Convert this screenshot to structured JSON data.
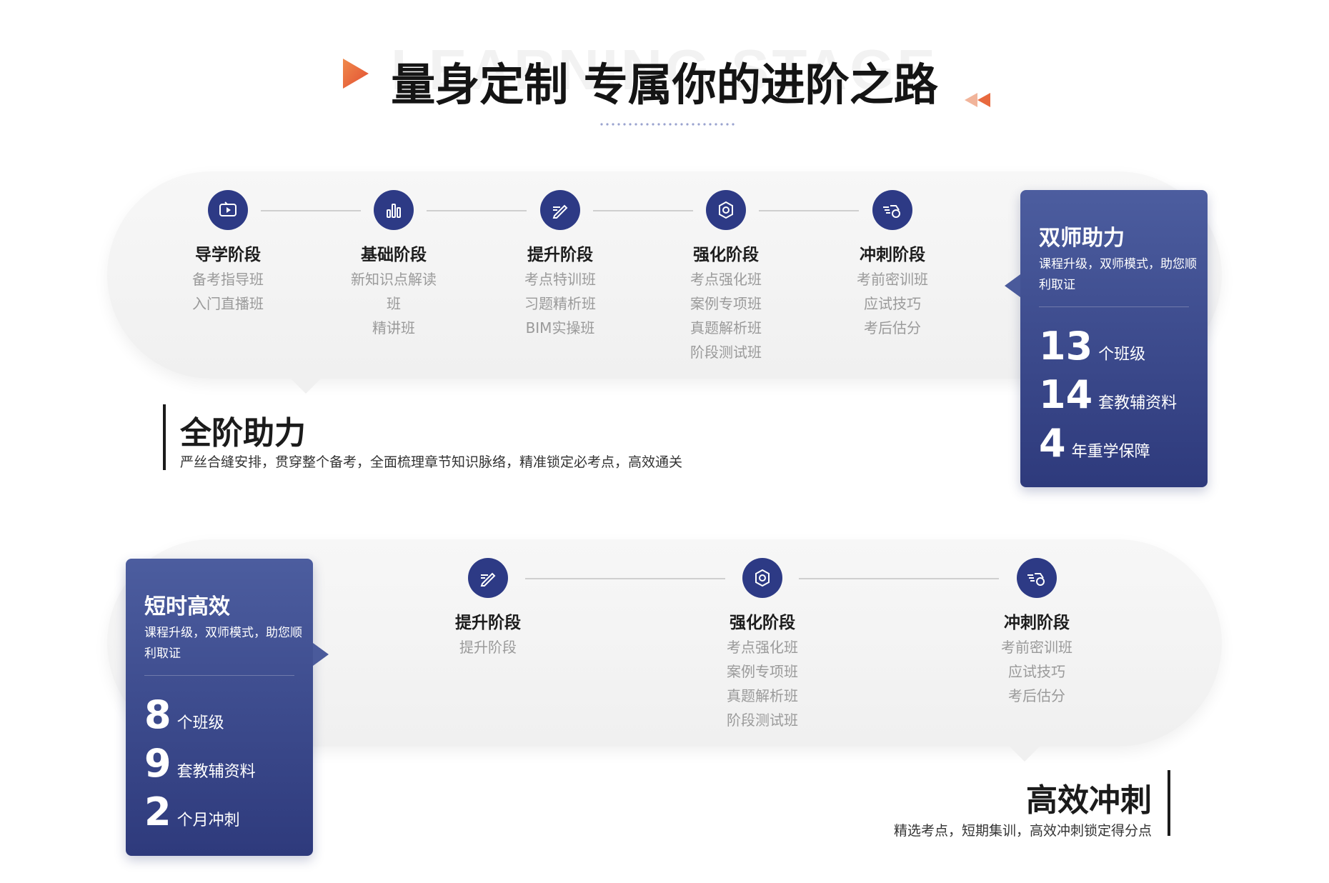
{
  "header": {
    "watermark": "LEARNING STAGE",
    "title": "量身定制 专属你的进阶之路"
  },
  "colors": {
    "accent": "#e8693e",
    "card": "#3a4788",
    "icon": "#2d3a85"
  },
  "section1": {
    "stages": [
      {
        "icon": "video-icon",
        "title": "导学阶段",
        "items": [
          "备考指导班",
          "入门直播班"
        ]
      },
      {
        "icon": "bar-chart-icon",
        "title": "基础阶段",
        "items": [
          "新知识点解读",
          "班",
          "精讲班"
        ]
      },
      {
        "icon": "pen-icon",
        "title": "提升阶段",
        "items": [
          "考点特训班",
          "习题精析班",
          "BIM实操班"
        ]
      },
      {
        "icon": "target-icon",
        "title": "强化阶段",
        "items": [
          "考点强化班",
          "案例专项班",
          "真题解析班",
          "阶段测试班"
        ]
      },
      {
        "icon": "sprint-icon",
        "title": "冲刺阶段",
        "items": [
          "考前密训班",
          "应试技巧",
          "考后估分"
        ]
      }
    ],
    "card": {
      "title": "双师助力",
      "desc": "课程升级，双师模式，助您顺利取证",
      "stats": [
        {
          "num": "13",
          "unit": "个班级"
        },
        {
          "num": "14",
          "unit": "套教辅资料"
        },
        {
          "num": "4",
          "unit": "年重学保障"
        }
      ]
    },
    "label": {
      "title": "全阶助力",
      "desc": "严丝合缝安排，贯穿整个备考，全面梳理章节知识脉络，精准锁定必考点，高效通关"
    }
  },
  "section2": {
    "stages": [
      {
        "icon": "pen-icon",
        "title": "提升阶段",
        "items": [
          "提升阶段"
        ]
      },
      {
        "icon": "target-icon",
        "title": "强化阶段",
        "items": [
          "考点强化班",
          "案例专项班",
          "真题解析班",
          "阶段测试班"
        ]
      },
      {
        "icon": "sprint-icon",
        "title": "冲刺阶段",
        "items": [
          "考前密训班",
          "应试技巧",
          "考后估分"
        ]
      }
    ],
    "card": {
      "title": "短时高效",
      "desc": "课程升级，双师模式，助您顺利取证",
      "stats": [
        {
          "num": "8",
          "unit": "个班级"
        },
        {
          "num": "9",
          "unit": "套教辅资料"
        },
        {
          "num": "2",
          "unit": "个月冲刺"
        }
      ]
    },
    "label": {
      "title": "高效冲刺",
      "desc": "精选考点，短期集训，高效冲刺锁定得分点"
    }
  }
}
